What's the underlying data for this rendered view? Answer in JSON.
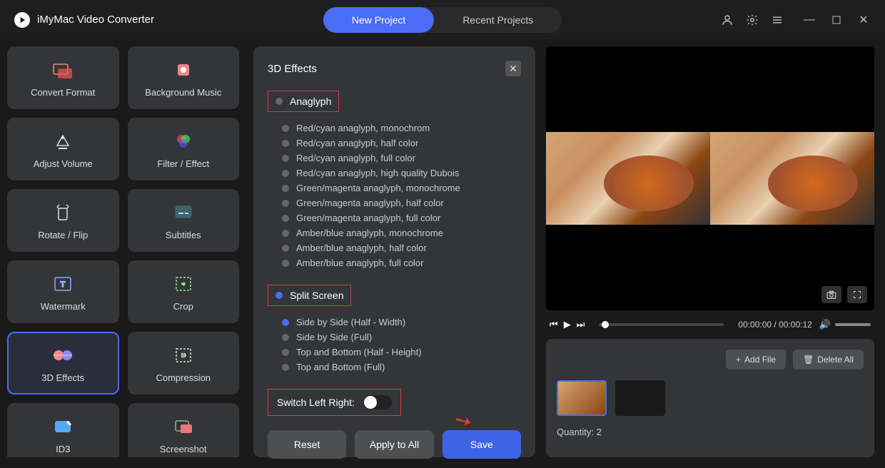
{
  "app": {
    "title": "iMyMac Video Converter"
  },
  "header": {
    "tabs": {
      "new_project": "New Project",
      "recent_projects": "Recent Projects"
    }
  },
  "tools": [
    {
      "id": "convert-format",
      "label": "Convert Format"
    },
    {
      "id": "background-music",
      "label": "Background Music"
    },
    {
      "id": "adjust-volume",
      "label": "Adjust Volume"
    },
    {
      "id": "filter-effect",
      "label": "Filter / Effect"
    },
    {
      "id": "rotate-flip",
      "label": "Rotate / Flip"
    },
    {
      "id": "subtitles",
      "label": "Subtitles"
    },
    {
      "id": "watermark",
      "label": "Watermark"
    },
    {
      "id": "crop",
      "label": "Crop"
    },
    {
      "id": "3d-effects",
      "label": "3D Effects",
      "active": true
    },
    {
      "id": "compression",
      "label": "Compression"
    },
    {
      "id": "id3",
      "label": "ID3"
    },
    {
      "id": "screenshot",
      "label": "Screenshot"
    }
  ],
  "panel": {
    "title": "3D Effects",
    "anaglyph": {
      "label": "Anaglyph",
      "options": [
        "Red/cyan anaglyph, monochrom",
        "Red/cyan anaglyph, half color",
        "Red/cyan anaglyph, full color",
        "Red/cyan anaglyph, high quality Dubois",
        "Green/magenta anaglyph, monochrome",
        "Green/magenta anaglyph, half color",
        "Green/magenta anaglyph, full color",
        "Amber/blue anaglyph, monochrome",
        "Amber/blue anaglyph, half color",
        "Amber/blue anaglyph, full color"
      ]
    },
    "split_screen": {
      "label": "Split Screen",
      "active": true,
      "options": [
        {
          "label": "Side by Side (Half - Width)",
          "selected": true
        },
        {
          "label": "Side by Side (Full)",
          "selected": false
        },
        {
          "label": "Top and Bottom (Half - Height)",
          "selected": false
        },
        {
          "label": "Top and Bottom (Full)",
          "selected": false
        }
      ]
    },
    "switch_lr": {
      "label": "Switch Left Right:",
      "value": false
    },
    "actions": {
      "reset": "Reset",
      "apply_all": "Apply to All",
      "save": "Save"
    }
  },
  "playback": {
    "current": "00:00:00",
    "total": "00:00:12"
  },
  "files": {
    "add_label": "Add File",
    "delete_label": "Delete All",
    "quantity_label": "Quantity:",
    "quantity_value": "2"
  }
}
